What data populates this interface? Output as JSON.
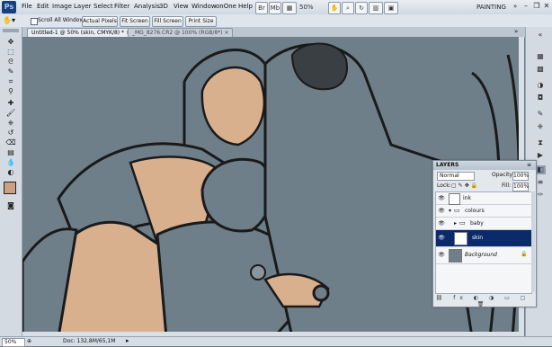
{
  "menu": {
    "items": [
      "File",
      "Edit",
      "Image",
      "Layer",
      "Select",
      "Filter",
      "Analysis",
      "3D",
      "View",
      "Window",
      "onOne",
      "Help"
    ],
    "zoom": "50%",
    "workspace": "PAINTING"
  },
  "options": {
    "scroll_all_windows": "Scroll All Windows",
    "actual_pixels": "Actual Pixels",
    "fit_screen": "Fit Screen",
    "fill_screen": "Fill Screen",
    "print_size": "Print Size"
  },
  "tabs": [
    {
      "label": "Untitled-1 @ 50% (skin, CMYK/8) *"
    },
    {
      "label": "_MG_8276.CR2 @ 100% (RGB/8*)"
    }
  ],
  "layers": {
    "title": "LAYERS",
    "blend_mode": "Normal",
    "opacity_label": "Opacity:",
    "opacity": "100%",
    "lock_label": "Lock:",
    "fill_label": "Fill:",
    "fill": "100%",
    "rows": [
      {
        "name": "ink"
      },
      {
        "name": "colours"
      },
      {
        "name": "baby"
      },
      {
        "name": "skin"
      },
      {
        "name": "Background"
      }
    ]
  },
  "status": {
    "zoom": "50%",
    "doc": "Doc: 132,8M/65,1M"
  },
  "colors": {
    "foreground": "#c9a081",
    "background": "#f2f2f2",
    "canvas": "#6e7f8a",
    "skin": "#d8b08e",
    "selected_layer": "#0b2a6b"
  }
}
